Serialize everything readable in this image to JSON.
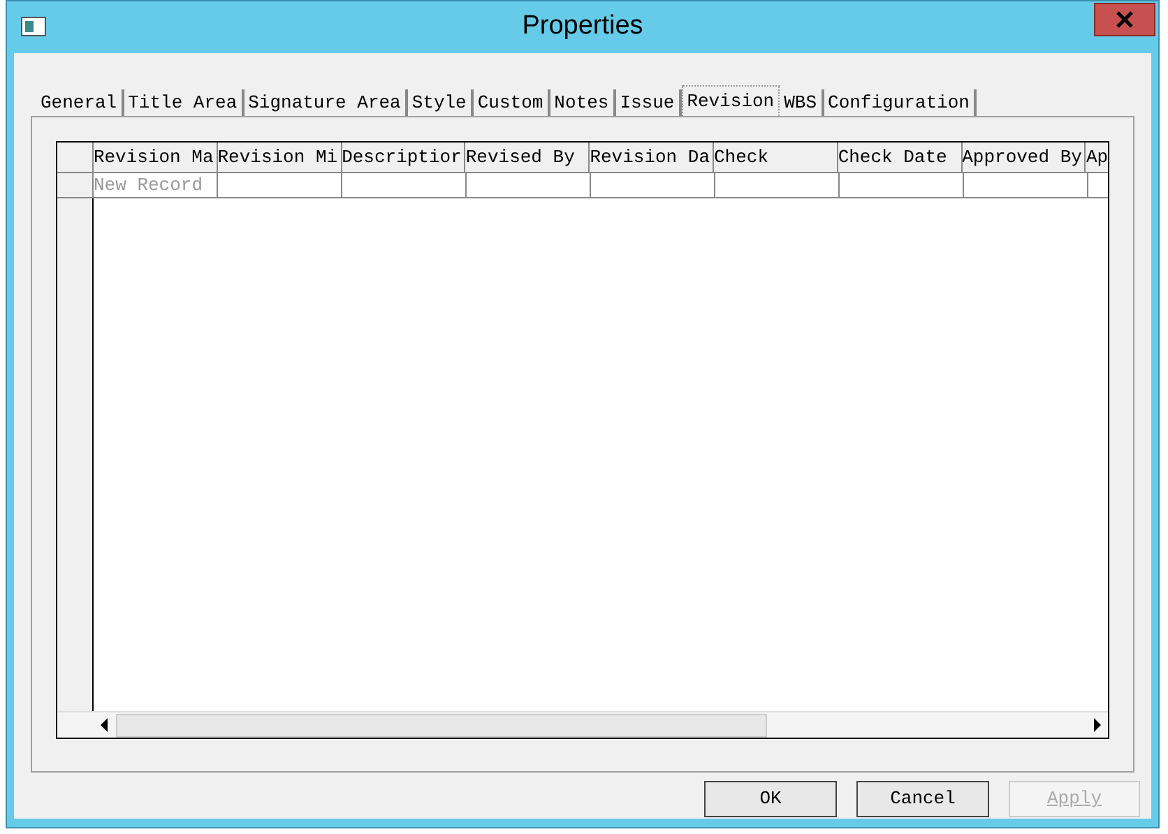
{
  "window": {
    "title": "Properties"
  },
  "tabs": [
    {
      "label": "General",
      "selected": false
    },
    {
      "label": "Title Area",
      "selected": false
    },
    {
      "label": "Signature Area",
      "selected": false
    },
    {
      "label": "Style",
      "selected": false
    },
    {
      "label": "Custom",
      "selected": false
    },
    {
      "label": "Notes",
      "selected": false
    },
    {
      "label": "Issue",
      "selected": false
    },
    {
      "label": "Revision",
      "selected": true
    },
    {
      "label": "WBS",
      "selected": false
    },
    {
      "label": "Configuration",
      "selected": false
    }
  ],
  "grid": {
    "columns": [
      "Revision Ma",
      "Revision Mi",
      "Descriptior",
      "Revised By",
      "Revision Da",
      "Check",
      "Check Date",
      "Approved By",
      "Ap"
    ],
    "new_row": {
      "placeholder": "New Record"
    }
  },
  "buttons": [
    {
      "label": "OK",
      "disabled": false
    },
    {
      "label": "Cancel",
      "disabled": false
    },
    {
      "label": "Apply",
      "disabled": true
    }
  ]
}
